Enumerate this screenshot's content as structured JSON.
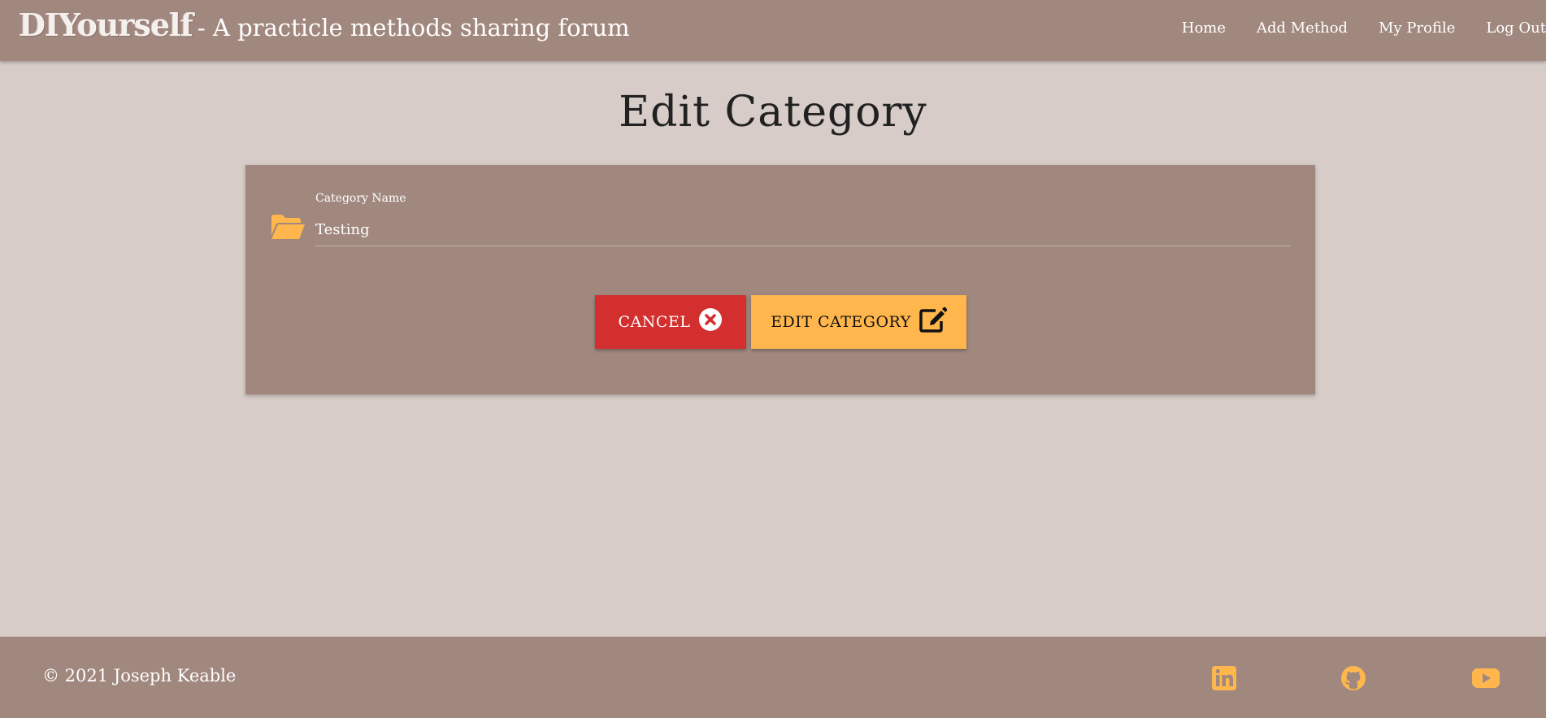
{
  "navbar": {
    "brand_logo": "DIYourself",
    "brand_tagline": "- A practicle methods sharing forum",
    "links": [
      "Home",
      "Add Method",
      "My Profile",
      "Log Out"
    ]
  },
  "page": {
    "title": "Edit Category"
  },
  "form": {
    "folder_icon": "folder-open-icon",
    "label": "Category Name",
    "value": "Testing",
    "cancel_label": "Cancel",
    "cancel_icon": "times-circle-icon",
    "submit_label": "Edit Category",
    "submit_icon": "edit-icon"
  },
  "footer": {
    "copyright": "© 2021 Joseph Keable",
    "social": [
      "linkedin-icon",
      "github-icon",
      "youtube-icon"
    ]
  },
  "colors": {
    "primary": "#a1887f",
    "background": "#d7ccc8",
    "accent": "#ffb74d",
    "danger": "#d32f2f"
  }
}
